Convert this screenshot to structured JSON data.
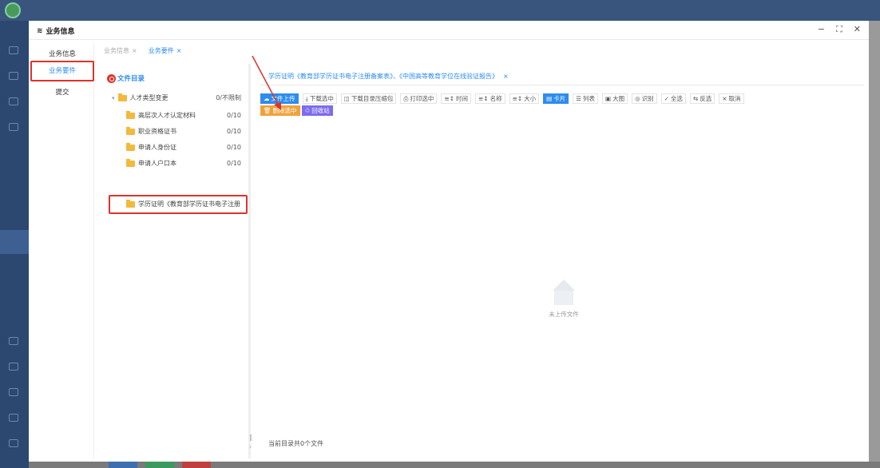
{
  "dialog": {
    "title": "业务信息",
    "title_icon": "stack-icon",
    "controls": [
      "−",
      "⛶",
      "✕"
    ]
  },
  "leftnav": {
    "items": [
      {
        "label": "业务信息"
      },
      {
        "label": "业务要件"
      },
      {
        "label": "提交"
      }
    ]
  },
  "tabs": [
    {
      "label": "业务信息",
      "close": "×"
    },
    {
      "label": "业务要件",
      "close": "×"
    }
  ],
  "directory": {
    "title": "文件目录",
    "root": {
      "label": "人才类型变更",
      "count": "0/不限制"
    },
    "items": [
      {
        "label": "高层次人才认定材料",
        "count": "0/10"
      },
      {
        "label": "职业资格证书",
        "count": "0/10"
      },
      {
        "label": "申请人身份证",
        "count": "0/10"
      },
      {
        "label": "申请人户口本",
        "count": "0/10"
      },
      {
        "label": "学历证明《教育部学历证书电子注册",
        "count": ""
      }
    ]
  },
  "content": {
    "tab_label": "学历证明《教育部学历证书电子注册备案表》、《中国高等教育学位在线验证报告》",
    "tab_close": "×",
    "toolbar": [
      {
        "icon": "upload-icon",
        "label": "文件上传"
      },
      {
        "icon": "download-icon",
        "label": "下载选中"
      },
      {
        "icon": "archive-icon",
        "label": "下载目录压缩包"
      },
      {
        "icon": "print-icon",
        "label": "打印选中"
      },
      {
        "icon": "sort-icon",
        "label": "时间"
      },
      {
        "icon": "sort-icon",
        "label": "名称"
      },
      {
        "icon": "sort-icon",
        "label": "大小"
      },
      {
        "icon": "card-icon",
        "label": "卡片"
      },
      {
        "icon": "list-icon",
        "label": "列表"
      },
      {
        "icon": "image-icon",
        "label": "大图"
      },
      {
        "icon": "recognize-icon",
        "label": "识别"
      },
      {
        "icon": "check-all-icon",
        "label": "全选"
      },
      {
        "icon": "invert-icon",
        "label": "反选"
      },
      {
        "icon": "cancel-icon",
        "label": "取消"
      }
    ],
    "toolbar2": [
      {
        "icon": "trash-icon",
        "label": "删除选中"
      },
      {
        "icon": "recycle-icon",
        "label": "回收站"
      }
    ],
    "empty_text": "未上传文件",
    "footer": "当前目录共0个文件"
  },
  "colors": {
    "accent": "#2d8cf0",
    "highlight": "#e0322b",
    "warn": "#f0a23a",
    "purple": "#7d6cf0"
  }
}
